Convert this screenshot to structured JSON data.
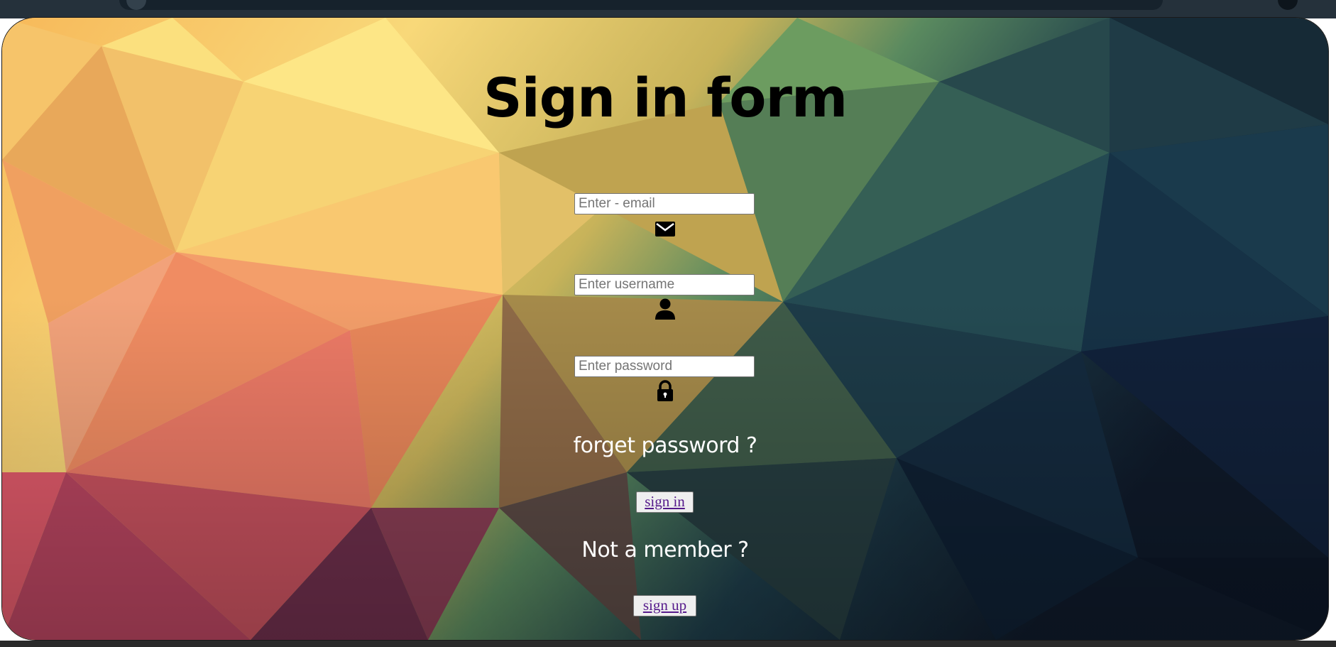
{
  "form": {
    "title": "Sign in form",
    "email": {
      "placeholder": "Enter - email",
      "value": "",
      "icon": "envelope-icon"
    },
    "username": {
      "placeholder": "Enter username",
      "value": "",
      "icon": "user-icon"
    },
    "password": {
      "placeholder": "Enter password",
      "value": "",
      "icon": "lock-icon"
    },
    "forgot_link": "forget password ?",
    "sign_in_label": "sign in",
    "not_member_text": "Not a member ?",
    "sign_up_label": "sign up"
  },
  "colors": {
    "title": "#000000",
    "link_text": "#ffffff",
    "button_link": "#551a8b",
    "background_warm": "#f5c466",
    "background_cool": "#1a3344"
  }
}
